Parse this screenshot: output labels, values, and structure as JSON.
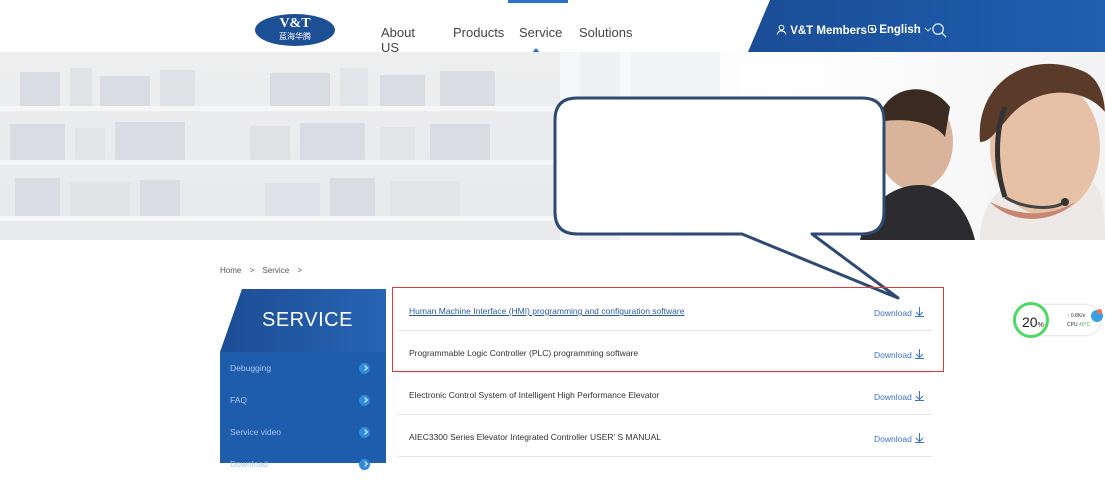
{
  "header": {
    "logo_top": "V&T",
    "logo_bottom": "蓝海华腾",
    "nav": [
      "About US",
      "Products",
      "Service",
      "Solutions"
    ],
    "active_nav": "Service",
    "members_label": "V&T Members",
    "language_label": "English"
  },
  "breadcrumb": [
    "Home",
    ">",
    "Service",
    ">"
  ],
  "sidebar": {
    "title": "SERVICE",
    "items": [
      "Debugging",
      "FAQ",
      "Service video",
      "Download"
    ]
  },
  "downloads": [
    {
      "name": "Human Machine Interface (HMI) programming and configuration software",
      "action": "Download"
    },
    {
      "name": "Programmable Logic Controller (PLC) programming software",
      "action": "Download"
    },
    {
      "name": "Electronic Control System of Intelligent High Performance Elevator",
      "action": "Download"
    },
    {
      "name": "AIEC3300 Series Elevator Integrated Controller USER’ S MANUAL",
      "action": "Download"
    }
  ],
  "widget": {
    "percent": "20",
    "percent_unit": "%",
    "speed": "↑ 0.8K/s",
    "cpu_label": "CPU",
    "cpu_temp": "40°C"
  },
  "colors": {
    "brand_blue": "#1d4f95",
    "highlight_red": "#e53935",
    "link_blue": "#3b73c4"
  }
}
